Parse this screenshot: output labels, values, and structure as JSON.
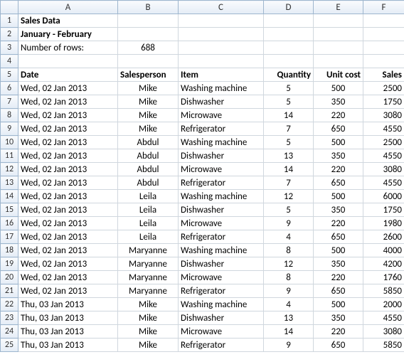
{
  "columns": [
    "A",
    "B",
    "C",
    "D",
    "E",
    "F"
  ],
  "title": "Sales Data",
  "subtitle": "January - February",
  "numrows_label": "Number of rows:",
  "numrows_value": "688",
  "headers": {
    "date": "Date",
    "salesperson": "Salesperson",
    "item": "Item",
    "quantity": "Quantity",
    "unitcost": "Unit cost",
    "sales": "Sales"
  },
  "rows": [
    {
      "n": 6,
      "date": "Wed, 02 Jan 2013",
      "sp": "Mike",
      "item": "Washing machine",
      "qty": "5",
      "uc": "500",
      "sales": "2500"
    },
    {
      "n": 7,
      "date": "Wed, 02 Jan 2013",
      "sp": "Mike",
      "item": "Dishwasher",
      "qty": "5",
      "uc": "350",
      "sales": "1750"
    },
    {
      "n": 8,
      "date": "Wed, 02 Jan 2013",
      "sp": "Mike",
      "item": "Microwave",
      "qty": "14",
      "uc": "220",
      "sales": "3080"
    },
    {
      "n": 9,
      "date": "Wed, 02 Jan 2013",
      "sp": "Mike",
      "item": "Refrigerator",
      "qty": "7",
      "uc": "650",
      "sales": "4550"
    },
    {
      "n": 10,
      "date": "Wed, 02 Jan 2013",
      "sp": "Abdul",
      "item": "Washing machine",
      "qty": "5",
      "uc": "500",
      "sales": "2500"
    },
    {
      "n": 11,
      "date": "Wed, 02 Jan 2013",
      "sp": "Abdul",
      "item": "Dishwasher",
      "qty": "13",
      "uc": "350",
      "sales": "4550"
    },
    {
      "n": 12,
      "date": "Wed, 02 Jan 2013",
      "sp": "Abdul",
      "item": "Microwave",
      "qty": "14",
      "uc": "220",
      "sales": "3080"
    },
    {
      "n": 13,
      "date": "Wed, 02 Jan 2013",
      "sp": "Abdul",
      "item": "Refrigerator",
      "qty": "7",
      "uc": "650",
      "sales": "4550"
    },
    {
      "n": 14,
      "date": "Wed, 02 Jan 2013",
      "sp": "Leila",
      "item": "Washing machine",
      "qty": "12",
      "uc": "500",
      "sales": "6000"
    },
    {
      "n": 15,
      "date": "Wed, 02 Jan 2013",
      "sp": "Leila",
      "item": "Dishwasher",
      "qty": "5",
      "uc": "350",
      "sales": "1750"
    },
    {
      "n": 16,
      "date": "Wed, 02 Jan 2013",
      "sp": "Leila",
      "item": "Microwave",
      "qty": "9",
      "uc": "220",
      "sales": "1980"
    },
    {
      "n": 17,
      "date": "Wed, 02 Jan 2013",
      "sp": "Leila",
      "item": "Refrigerator",
      "qty": "4",
      "uc": "650",
      "sales": "2600"
    },
    {
      "n": 18,
      "date": "Wed, 02 Jan 2013",
      "sp": "Maryanne",
      "item": "Washing machine",
      "qty": "8",
      "uc": "500",
      "sales": "4000"
    },
    {
      "n": 19,
      "date": "Wed, 02 Jan 2013",
      "sp": "Maryanne",
      "item": "Dishwasher",
      "qty": "12",
      "uc": "350",
      "sales": "4200"
    },
    {
      "n": 20,
      "date": "Wed, 02 Jan 2013",
      "sp": "Maryanne",
      "item": "Microwave",
      "qty": "8",
      "uc": "220",
      "sales": "1760"
    },
    {
      "n": 21,
      "date": "Wed, 02 Jan 2013",
      "sp": "Maryanne",
      "item": "Refrigerator",
      "qty": "9",
      "uc": "650",
      "sales": "5850"
    },
    {
      "n": 22,
      "date": "Thu, 03 Jan 2013",
      "sp": "Mike",
      "item": "Washing machine",
      "qty": "4",
      "uc": "500",
      "sales": "2000"
    },
    {
      "n": 23,
      "date": "Thu, 03 Jan 2013",
      "sp": "Mike",
      "item": "Dishwasher",
      "qty": "13",
      "uc": "350",
      "sales": "4550"
    },
    {
      "n": 24,
      "date": "Thu, 03 Jan 2013",
      "sp": "Mike",
      "item": "Microwave",
      "qty": "14",
      "uc": "220",
      "sales": "3080"
    },
    {
      "n": 25,
      "date": "Thu, 03 Jan 2013",
      "sp": "Mike",
      "item": "Refrigerator",
      "qty": "9",
      "uc": "650",
      "sales": "5850"
    }
  ]
}
